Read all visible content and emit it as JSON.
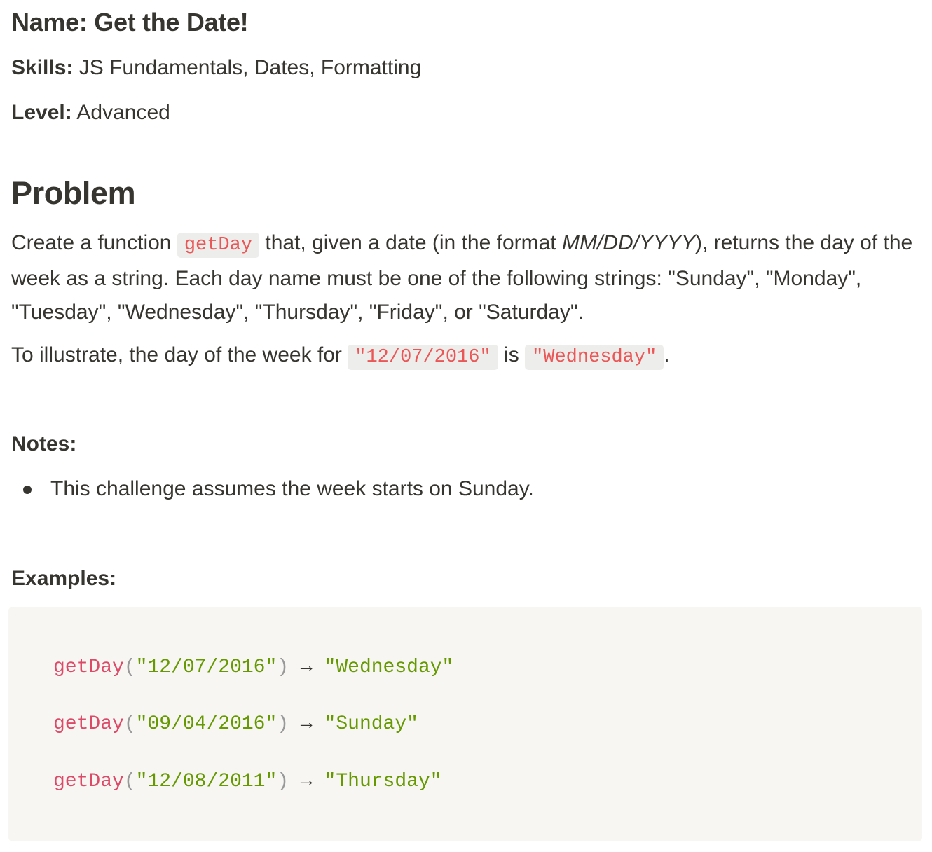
{
  "header": {
    "title": "Name: Get the Date!",
    "skills_label": "Skills:",
    "skills_value": "JS Fundamentals, Dates, Formatting",
    "level_label": "Level:",
    "level_value": "Advanced"
  },
  "problem": {
    "heading": "Problem",
    "p1_a": "Create a function",
    "p1_code": "getDay",
    "p1_b": "that, given a date (in the format",
    "p1_format": "MM/DD/YYYY",
    "p1_c": "), returns the day of the week as a string. Each day name must be one of the following strings: \"Sunday\", \"Monday\", \"Tuesday\", \"Wednesday\", \"Thursday\", \"Friday\", or \"Saturday\".",
    "p2_a": "To illustrate, the day of the week for",
    "p2_code1": "\"12/07/2016\"",
    "p2_b": "is",
    "p2_code2": "\"Wednesday\"",
    "p2_c": "."
  },
  "notes": {
    "heading": "Notes:",
    "items": [
      "This challenge assumes the week starts on Sunday."
    ]
  },
  "examples": {
    "heading": "Examples:",
    "arrow": "→",
    "lines": [
      {
        "fn": "getDay",
        "open": "(",
        "arg": "\"12/07/2016\"",
        "close": ")",
        "result": "\"Wednesday\""
      },
      {
        "fn": "getDay",
        "open": "(",
        "arg": "\"09/04/2016\"",
        "close": ")",
        "result": "\"Sunday\""
      },
      {
        "fn": "getDay",
        "open": "(",
        "arg": "\"12/08/2011\"",
        "close": ")",
        "result": "\"Thursday\""
      }
    ]
  }
}
